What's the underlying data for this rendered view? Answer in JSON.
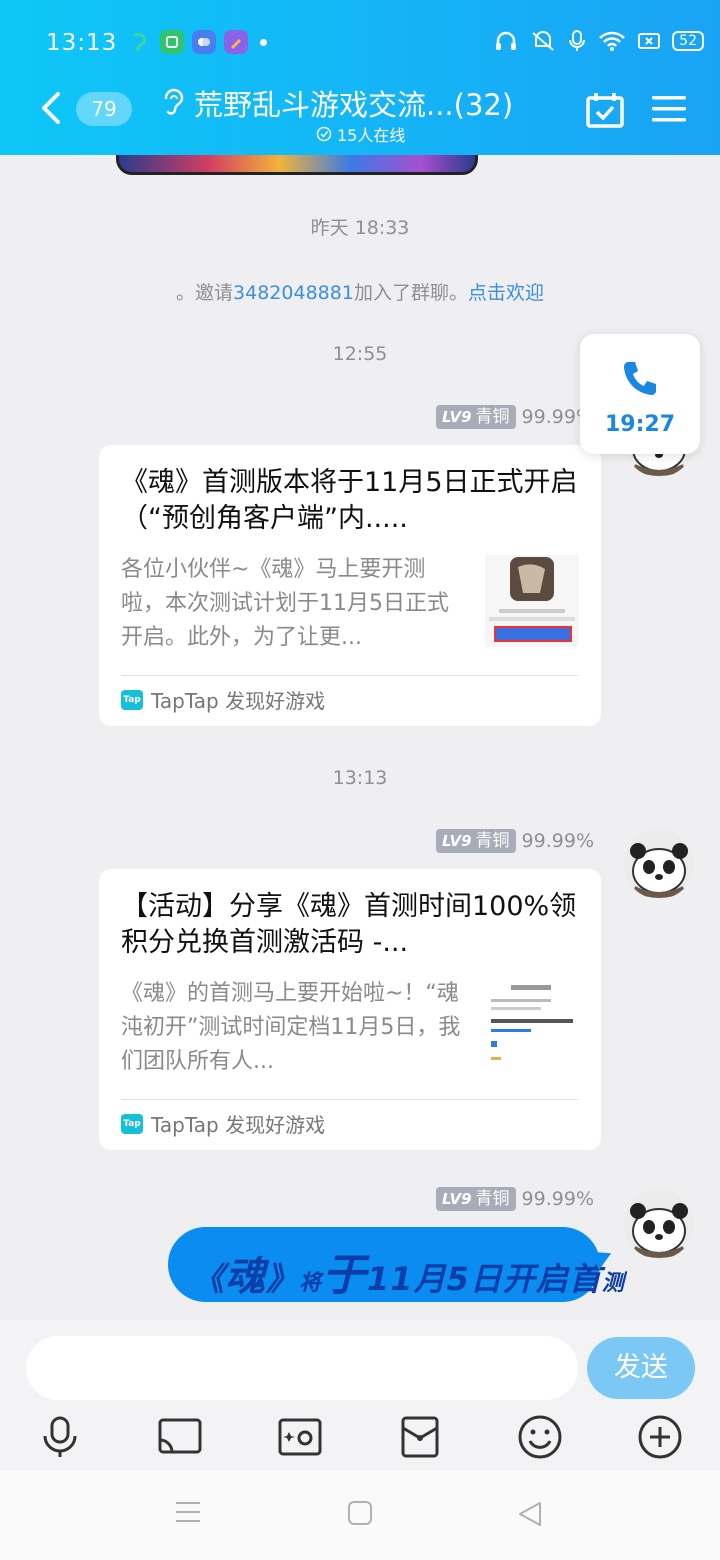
{
  "status_bar": {
    "time": "13:13",
    "battery": "52"
  },
  "header": {
    "unread_count": "79",
    "title": "荒野乱斗游戏交流...(32)",
    "online": "15人在线"
  },
  "messages": {
    "ts1": "昨天 18:33",
    "system": {
      "prefix": "。邀请",
      "user": "3482048881",
      "suffix": "加入了群聊。",
      "action": "点击欢迎"
    },
    "ts2": "12:55",
    "ts3": "13:13",
    "sender": {
      "level": "LV9",
      "rank": "青铜",
      "percent": "99.99%"
    },
    "card1": {
      "title": "《魂》首测版本将于11月5日正式开启（“预创角客户端”内.....",
      "desc": "各位小伙伴~《魂》马上要开测啦，本次测试计划于11月5日正式开启。此外，为了让更...",
      "source": "TapTap 发现好游戏"
    },
    "card2": {
      "title": "【活动】分享《魂》首测时间100%领积分兑换首测激活码 -...",
      "desc": "《魂》的首测马上要开始啦~！“魂沌初开”测试时间定档11月5日，我们团队所有人...",
      "source": "TapTap 发现好游戏"
    },
    "bubble": {
      "p1": "《",
      "p2": "魂",
      "p3": "》",
      "p4": "将",
      "p5": "于",
      "p6": "11月5日开启首",
      "p7": "测"
    }
  },
  "call_widget": {
    "duration": "19:27"
  },
  "input": {
    "send_label": "发送",
    "placeholder": ""
  },
  "colors": {
    "header_start": "#0ec7f7",
    "header_end": "#1aa3f5",
    "accent": "#1a87e0",
    "bubble": "#0a8cf0"
  }
}
